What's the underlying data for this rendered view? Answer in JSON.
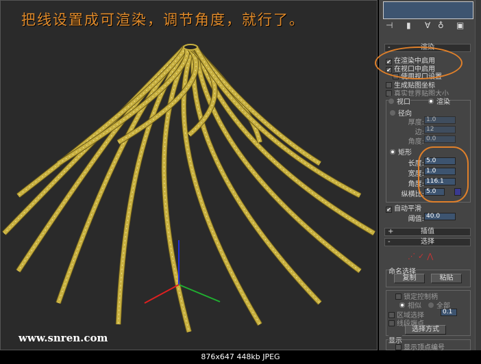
{
  "viewport": {
    "caption": "把线设置成可渲染，调节角度，就行了。",
    "watermark": "www.snren.com",
    "wire_color": "#c8b040",
    "bg": "#2a2a2a"
  },
  "panel": {
    "toolbar_icons": [
      "pin-icon",
      "stack-icon",
      "funnel-icon",
      "hammer-icon",
      "display-icon"
    ],
    "rendering": {
      "title": "渲染",
      "collapse": "-",
      "enable_in_renderer": {
        "label": "在渲染中启用",
        "checked": true
      },
      "enable_in_viewport": {
        "label": "在视口中启用",
        "checked": true
      },
      "use_viewport_settings": {
        "label": "使用视口设置",
        "checked": false
      },
      "generate_mapping": {
        "label": "生成贴图坐标",
        "checked": false
      },
      "real_world_map": {
        "label": "真实世界贴图大小",
        "checked": false
      },
      "viewport_radio": "视口",
      "renderer_radio": "渲染",
      "radial": {
        "label": "径向",
        "thickness_label": "厚度:",
        "thickness": "1.0",
        "sides_label": "边:",
        "sides": "12",
        "angle_label": "角度:",
        "angle": "0.0"
      },
      "rectangular": {
        "label": "矩形",
        "length_label": "长度:",
        "length": "5.0",
        "width_label": "宽度:",
        "width": "1.0",
        "angle_label": "角度:",
        "angle": "116.1",
        "aspect_label": "纵横比:",
        "aspect": "5.0"
      },
      "auto_smooth": {
        "label": "自动平滑",
        "checked": true,
        "threshold_label": "阈值:",
        "threshold": "40.0"
      }
    },
    "interpolation": {
      "title": "插值",
      "expand": "+"
    },
    "selection": {
      "title": "选择",
      "collapse": "-",
      "named_selection": "命名选择",
      "copy": "复制",
      "paste": "粘贴",
      "lock_handles": "锁定控制柄",
      "similar": "相似",
      "all": "全部",
      "area_selection": "区域选择",
      "area_value": "0.1",
      "segment_end": "线段端点",
      "select_by": "选择方式"
    },
    "display": {
      "title": "显示",
      "show_vertex_numbers": "显示顶点编号"
    }
  },
  "status": "876x647  448kb  JPEG"
}
